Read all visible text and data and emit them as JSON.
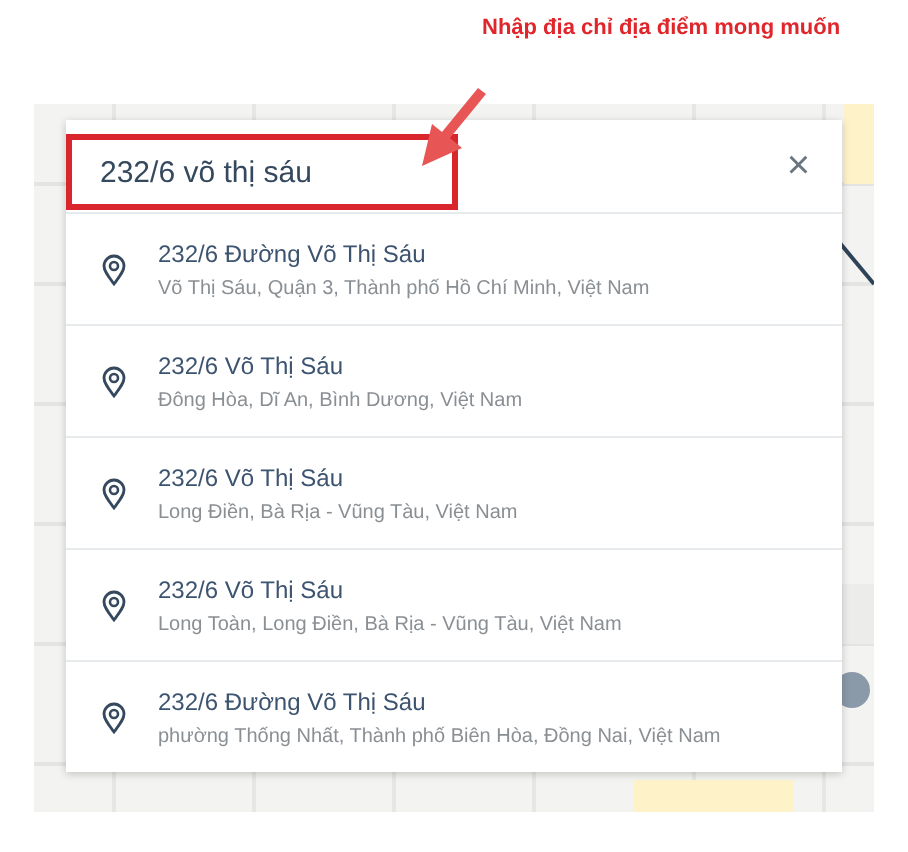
{
  "annotation": {
    "text": "Nhập địa chỉ địa điểm mong muốn"
  },
  "search": {
    "value": "232/6 võ thị sáu",
    "close": "×"
  },
  "results": [
    {
      "title": "232/6 Đường Võ Thị Sáu",
      "address": "Võ Thị Sáu, Quận 3, Thành phố Hồ Chí Minh, Việt Nam"
    },
    {
      "title": "232/6 Võ Thị Sáu",
      "address": "Đông Hòa, Dĩ An, Bình Dương, Việt Nam"
    },
    {
      "title": "232/6 Võ Thị Sáu",
      "address": "Long Điền, Bà Rịa - Vũng Tàu, Việt Nam"
    },
    {
      "title": "232/6 Võ Thị Sáu",
      "address": "Long Toàn, Long Điền, Bà Rịa - Vũng Tàu, Việt Nam"
    },
    {
      "title": "232/6 Đường Võ Thị Sáu",
      "address": "phường Thống Nhất, Thành phố Biên Hòa, Đồng Nai, Việt Nam"
    }
  ]
}
